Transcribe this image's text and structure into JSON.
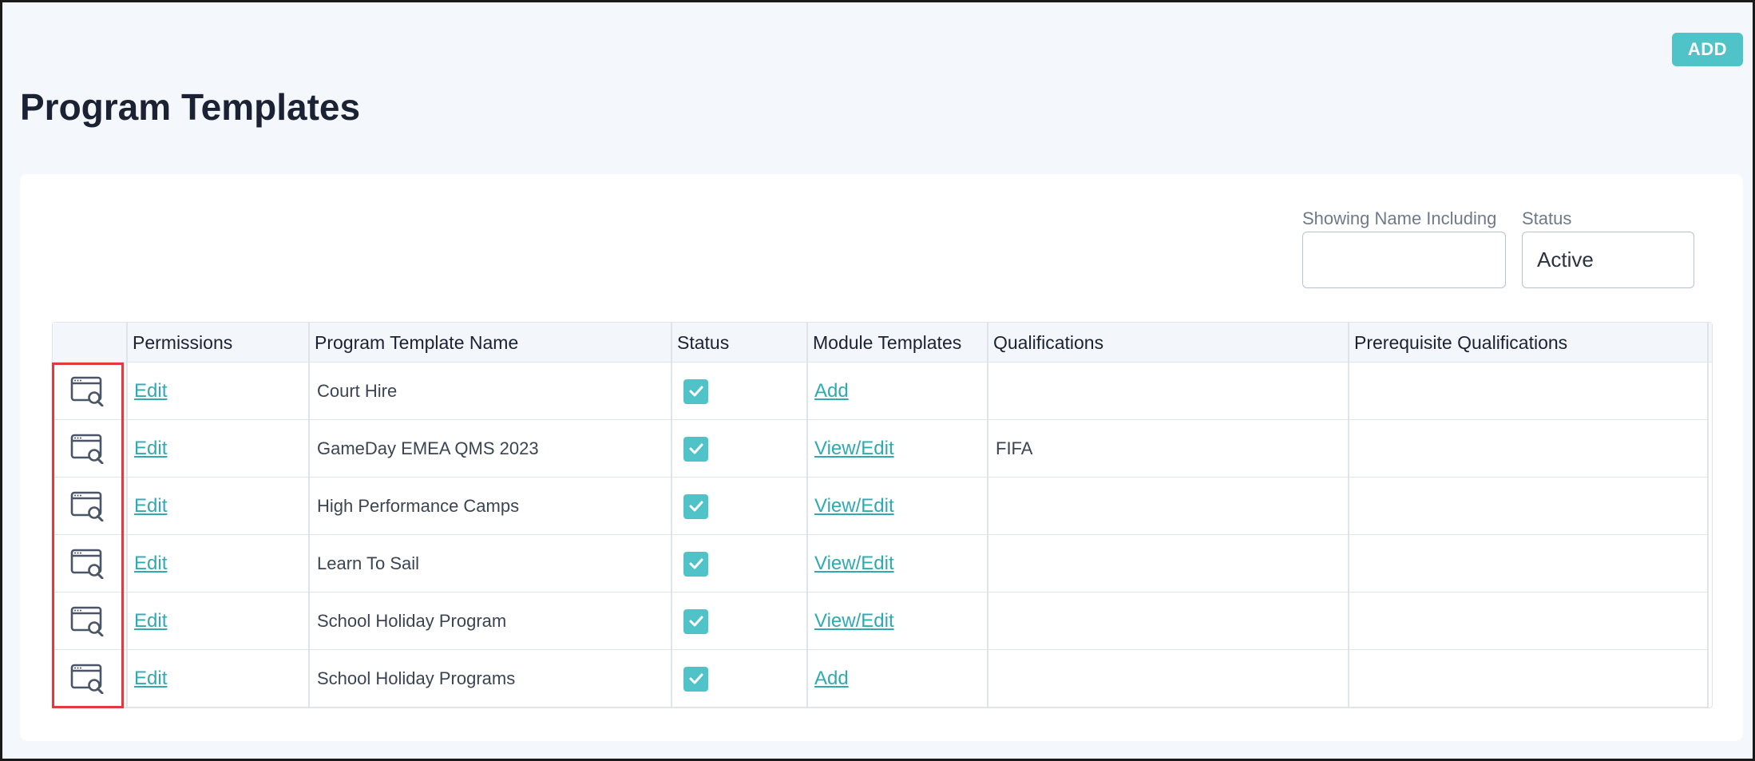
{
  "header": {
    "add_label": "ADD",
    "title": "Program Templates"
  },
  "filters": {
    "name_label": "Showing Name Including",
    "name_value": "",
    "status_label": "Status",
    "status_value": "Active"
  },
  "table": {
    "columns": [
      "",
      "Permissions",
      "Program Template Name",
      "Status",
      "Module Templates",
      "Qualifications",
      "Prerequisite Qualifications"
    ],
    "rows": [
      {
        "permissions": "Edit",
        "name": "Court Hire",
        "status_checked": true,
        "module": "Add",
        "qualifications": "",
        "prerequisite": ""
      },
      {
        "permissions": "Edit",
        "name": "GameDay EMEA QMS 2023",
        "status_checked": true,
        "module": "View/Edit",
        "qualifications": "FIFA",
        "prerequisite": ""
      },
      {
        "permissions": "Edit",
        "name": "High Performance Camps",
        "status_checked": true,
        "module": "View/Edit",
        "qualifications": "",
        "prerequisite": ""
      },
      {
        "permissions": "Edit",
        "name": "Learn To Sail",
        "status_checked": true,
        "module": "View/Edit",
        "qualifications": "",
        "prerequisite": ""
      },
      {
        "permissions": "Edit",
        "name": "School Holiday Program",
        "status_checked": true,
        "module": "View/Edit",
        "qualifications": "",
        "prerequisite": ""
      },
      {
        "permissions": "Edit",
        "name": "School Holiday Programs",
        "status_checked": true,
        "module": "Add",
        "qualifications": "",
        "prerequisite": ""
      }
    ]
  },
  "icons": {
    "row_action": "view-search-icon",
    "status": "checkbox-checked-icon"
  },
  "colors": {
    "accent": "#4fc3c8",
    "link": "#2eaab0",
    "highlight": "#e0393e",
    "title": "#1b2233"
  }
}
